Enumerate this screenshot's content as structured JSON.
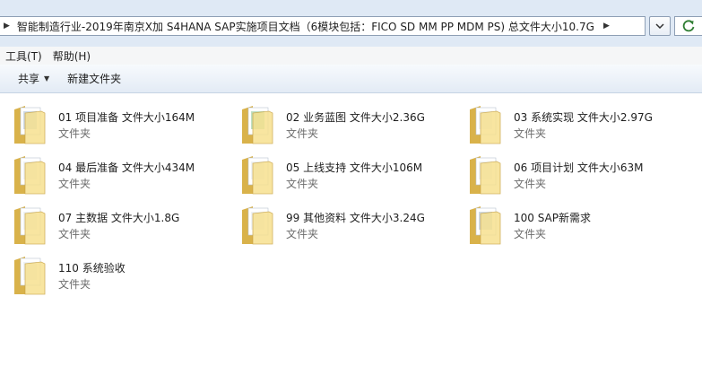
{
  "address_bar": {
    "path": "智能制造行业-2019年南京X加 S4HANA SAP实施项目文档（6模块包括：FICO SD MM PP MDM PS) 总文件大小10.7G"
  },
  "menu": {
    "items": [
      "工具(T)",
      "帮助(H)"
    ]
  },
  "toolbar": {
    "share_label": "共享",
    "new_folder_label": "新建文件夹"
  },
  "files": [
    {
      "name": "01 项目准备 文件大小164M",
      "type": "文件夹"
    },
    {
      "name": "02 业务蓝图 文件大小2.36G",
      "type": "文件夹"
    },
    {
      "name": "03 系统实现 文件大小2.97G",
      "type": "文件夹"
    },
    {
      "name": "04 最后准备 文件大小434M",
      "type": "文件夹"
    },
    {
      "name": "05 上线支持 文件大小106M",
      "type": "文件夹"
    },
    {
      "name": "06 项目计划 文件大小63M",
      "type": "文件夹"
    },
    {
      "name": "07 主数据 文件大小1.8G",
      "type": "文件夹"
    },
    {
      "name": "99 其他资料 文件大小3.24G",
      "type": "文件夹"
    },
    {
      "name": "100 SAP新需求",
      "type": "文件夹"
    },
    {
      "name": "110 系统验收",
      "type": "文件夹"
    }
  ],
  "colors": {
    "folder_light": "#f7e08c",
    "folder_dark": "#d9b24a",
    "chrome": "#dfe9f5"
  }
}
